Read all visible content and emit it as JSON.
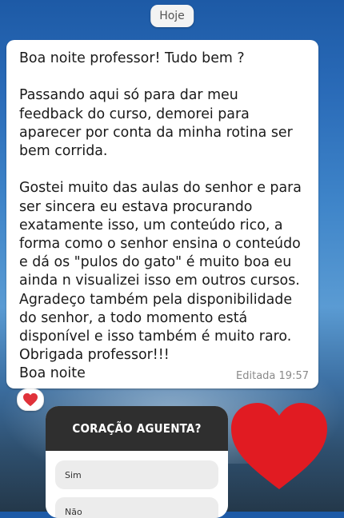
{
  "date_label": "Hoje",
  "message": {
    "text": "Boa noite professor! Tudo bem ?\n\nPassando aqui só para dar meu feedback do curso, demorei para aparecer por conta da minha rotina ser bem corrida.\n\nGostei muito das aulas do senhor e para ser sincera eu estava procurando exatamente isso, um conteúdo rico, a forma como o senhor ensina o conteúdo e dá os \"pulos do gato\" é muito boa eu ainda n visualizei isso em outros cursos. Agradeço também pela disponibilidade do senhor, a todo momento está disponível e isso também é muito raro. Obrigada professor!!!\nBoa noite",
    "meta": "Editada  19:57",
    "reaction_icon": "heart-emoji",
    "reaction_color": "#e0323a"
  },
  "poll": {
    "question": "CORAÇÃO AGUENTA?",
    "options": [
      "Sim",
      "Não"
    ]
  },
  "sticker": {
    "icon": "red-heart",
    "color": "#e11b22"
  }
}
